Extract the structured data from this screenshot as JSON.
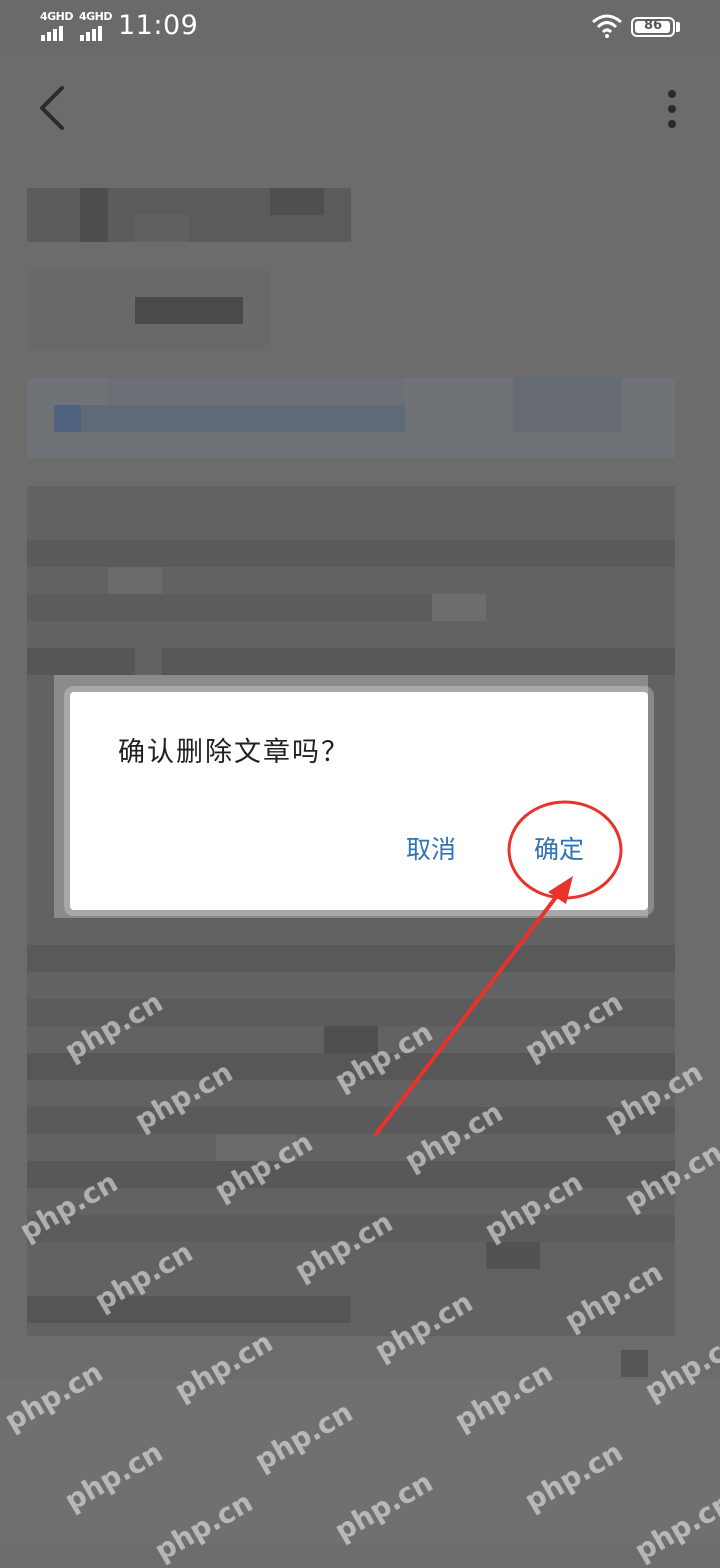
{
  "status_bar": {
    "network_1": "4GHD",
    "network_2": "4GHD",
    "time": "11:09",
    "battery": "86"
  },
  "header": {
    "back_icon": "chevron-left-icon",
    "more_icon": "more-vertical-icon"
  },
  "dialog": {
    "title": "确认删除文章吗？",
    "cancel_label": "取消",
    "confirm_label": "确定"
  },
  "watermark": "php.cn",
  "colors": {
    "overlay": "#6c6c6c",
    "dialog_bg": "#ffffff",
    "button_text": "#2e73b8",
    "annotation": "#e8322b"
  }
}
